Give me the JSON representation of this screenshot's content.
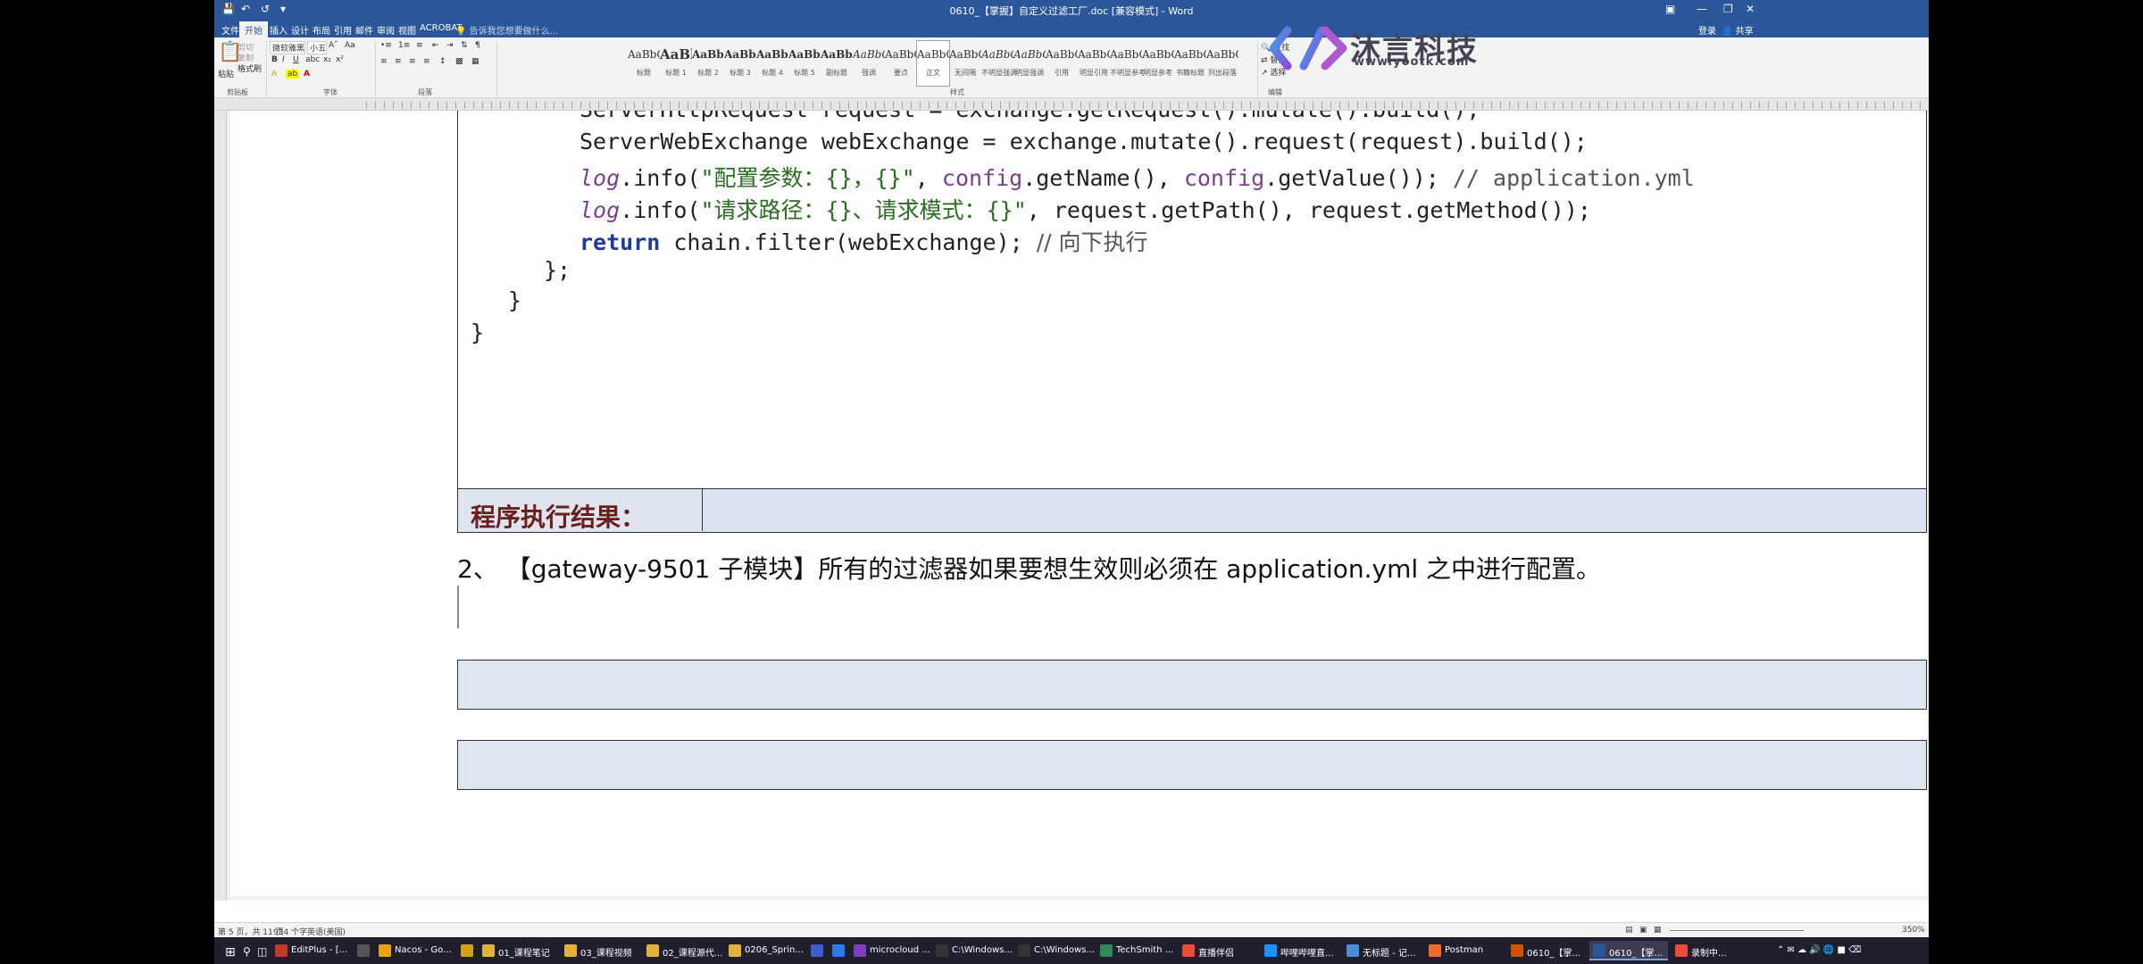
{
  "window": {
    "title": "0610_【掌握】自定义过滤工厂.doc [兼容模式] - Word",
    "login": "登录",
    "share": "共享"
  },
  "menu": {
    "tabs": [
      "文件",
      "开始",
      "插入",
      "设计",
      "布局",
      "引用",
      "邮件",
      "审阅",
      "视图",
      "ACROBAT"
    ],
    "active": "开始",
    "tell_me": "告诉我您想要做什么..."
  },
  "ribbon": {
    "clipboard": {
      "paste": "粘贴",
      "cut": "剪切",
      "copy": "复制",
      "format_painter": "格式刷",
      "group": "剪贴板"
    },
    "font": {
      "name": "微软雅黑",
      "size": "小五",
      "group": "字体"
    },
    "paragraph": {
      "group": "段落"
    },
    "styles": {
      "group": "样式",
      "items": [
        {
          "sample": "AaBbC",
          "name": "标题"
        },
        {
          "sample": "AaBl",
          "name": "标题 1"
        },
        {
          "sample": "AaBb(",
          "name": "标题 2"
        },
        {
          "sample": "AaBb(",
          "name": "标题 3"
        },
        {
          "sample": "AaBbC",
          "name": "标题 4"
        },
        {
          "sample": "AaBbC",
          "name": "标题 5"
        },
        {
          "sample": "AaBbC",
          "name": "副标题"
        },
        {
          "sample": "AaBbCcDi",
          "name": "强调"
        },
        {
          "sample": "AaBbCcD",
          "name": "要点"
        },
        {
          "sample": "AaBbCcDc",
          "name": "正文"
        },
        {
          "sample": "AaBbCcDc",
          "name": "无间隔"
        },
        {
          "sample": "AaBbCcDc",
          "name": "不明显强调"
        },
        {
          "sample": "AaBbCcDc",
          "name": "明显强调"
        },
        {
          "sample": "AaBbCcDc",
          "name": "引用"
        },
        {
          "sample": "AaBbCcDc",
          "name": "明显引用"
        },
        {
          "sample": "AaBbCcD",
          "name": "不明显参考"
        },
        {
          "sample": "AaBbCcI",
          "name": "明显参考"
        },
        {
          "sample": "AaBbCcD",
          "name": "书籍标题"
        },
        {
          "sample": "AaBbCcDc",
          "name": "列出段落"
        }
      ]
    },
    "editing": {
      "find": "查找",
      "replace": "替换",
      "select": "选择",
      "group": "编辑"
    }
  },
  "logo": {
    "name": "沐言科技",
    "url": "www.yootk.com"
  },
  "document": {
    "code_lines": [
      {
        "indent": 0,
        "parts": [
          {
            "t": "ServerHttpRequest request = exchange.getRequest().mutate().build();",
            "c": ""
          }
        ]
      },
      {
        "indent": 0,
        "parts": [
          {
            "t": "ServerWebExchange webExchange = exchange.mutate().request(request).build();",
            "c": ""
          }
        ]
      },
      {
        "indent": 0,
        "parts": [
          {
            "t": "log",
            "c": "c-it"
          },
          {
            "t": ".info(",
            "c": ""
          },
          {
            "t": "\"配置参数：{}，{}\"",
            "c": "c-str"
          },
          {
            "t": ", ",
            "c": ""
          },
          {
            "t": "config",
            "c": "c-field"
          },
          {
            "t": ".getName(), ",
            "c": ""
          },
          {
            "t": "config",
            "c": "c-field"
          },
          {
            "t": ".getValue()); ",
            "c": ""
          },
          {
            "t": "// application.yml",
            "c": "c-cm"
          }
        ]
      },
      {
        "indent": 0,
        "parts": [
          {
            "t": "log",
            "c": "c-it"
          },
          {
            "t": ".info(",
            "c": ""
          },
          {
            "t": "\"请求路径：{}、请求模式：{}\"",
            "c": "c-str"
          },
          {
            "t": ", request.getPath(), request.getMethod());",
            "c": ""
          }
        ]
      },
      {
        "indent": 0,
        "parts": [
          {
            "t": "return",
            "c": "c-kw"
          },
          {
            "t": " chain.filter(webExchange); ",
            "c": ""
          },
          {
            "t": "// 向下执行",
            "c": "c-cmcn"
          }
        ]
      },
      {
        "indent": 0,
        "parts": [
          {
            "t": "};",
            "c": ""
          }
        ]
      },
      {
        "indent": 0,
        "parts": [
          {
            "t": "}",
            "c": ""
          }
        ]
      },
      {
        "indent": 0,
        "parts": [
          {
            "t": "}",
            "c": ""
          }
        ]
      }
    ],
    "result_label": "程序执行结果：",
    "step_text": "2、 【gateway-9501 子模块】所有的过滤器如果要想生效则必须在 application.yml 之中进行配置。"
  },
  "status": {
    "page": "第 5 页，共 11 页",
    "words": "934 个字",
    "lang": "英语(美国)",
    "zoom": "350%"
  },
  "taskbar": {
    "items": [
      {
        "label": "EditPlus - [...",
        "color": "#c0392b"
      },
      {
        "label": "",
        "color": "#555"
      },
      {
        "label": "Nacos - Go...",
        "color": "#e8a317"
      },
      {
        "label": "",
        "color": "#d4a017"
      },
      {
        "label": "01_课程笔记",
        "color": "#e2b33c"
      },
      {
        "label": "03_课程视频",
        "color": "#e2b33c"
      },
      {
        "label": "02_课程源代...",
        "color": "#e2b33c"
      },
      {
        "label": "0206_Sprin...",
        "color": "#e2b33c"
      },
      {
        "label": "",
        "color": "#3a5fcd"
      },
      {
        "label": "",
        "color": "#2c7be5"
      },
      {
        "label": "microcloud ...",
        "color": "#7b3fbf"
      },
      {
        "label": "C:\\Windows...",
        "color": "#333"
      },
      {
        "label": "C:\\Windows...",
        "color": "#333"
      },
      {
        "label": "TechSmith ...",
        "color": "#2e8b57"
      },
      {
        "label": "直播伴侣",
        "color": "#e74c3c"
      },
      {
        "label": "哔哩哔哩直...",
        "color": "#1e90ff"
      },
      {
        "label": "无标题 - 记...",
        "color": "#4a90d9"
      },
      {
        "label": "Postman",
        "color": "#ef6c2f"
      },
      {
        "label": "0610_【掌...",
        "color": "#d35400"
      },
      {
        "label": "0610_【掌...",
        "color": "#2b579a"
      },
      {
        "label": "录制中...",
        "color": "#e74c3c"
      }
    ]
  }
}
